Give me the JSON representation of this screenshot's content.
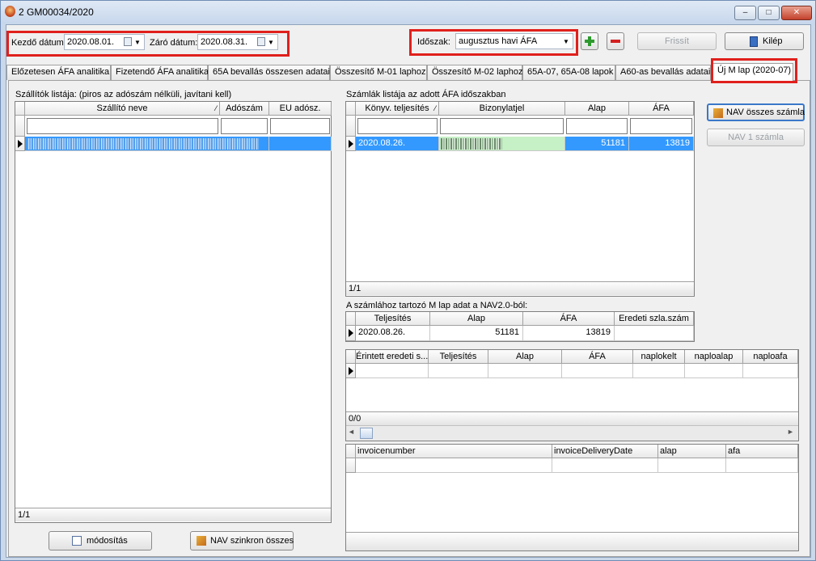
{
  "window": {
    "title": "2 GM00034/2020",
    "minimize": "–",
    "maximize": "□",
    "close": "✕"
  },
  "toolbar": {
    "start_label": "Kezdő dátum:",
    "start_value": "2020.08.01.",
    "end_label": "Záró dátum:",
    "end_value": "2020.08.31.",
    "period_label": "Időszak:",
    "period_value": "augusztus havi ÁFA",
    "refresh": "Frissít",
    "exit": "Kilép"
  },
  "tabs": [
    "Előzetesen ÁFA analitika",
    "Fizetendő ÁFA analitika",
    "65A bevallás összesen adatai",
    "Összesítő M-01 laphoz",
    "Összesítő M-02 laphoz",
    "65A-07, 65A-08 lapok",
    "A60-as bevallás adatai",
    "Új M lap (2020-07)"
  ],
  "suppliers": {
    "caption": "Szállítók listája: (piros az adószám nélküli, javítani kell)",
    "columns": [
      "Szállító neve",
      "Adószám",
      "EU adósz."
    ],
    "status": "1/1",
    "modify": "módosítás",
    "sync": "NAV szinkron összes"
  },
  "invoices": {
    "caption": "Számlák listája az adott ÁFA időszakban",
    "columns": [
      "Könyv. teljesítés",
      "Bizonylatjel",
      "Alap",
      "ÁFA"
    ],
    "rows": [
      {
        "date": "2020.08.26.",
        "alap": "51181",
        "afa": "13819"
      }
    ],
    "status": "1/1",
    "nav_all": "NAV összes számla",
    "nav_one": "NAV 1 számla"
  },
  "mlap": {
    "caption": "A számlához tartozó M lap adat a NAV2.0-ból:",
    "columns": [
      "Teljesítés",
      "Alap",
      "ÁFA",
      "Eredeti szla.szám"
    ],
    "rows": [
      {
        "date": "2020.08.26.",
        "alap": "51181",
        "afa": "13819",
        "orig": ""
      }
    ]
  },
  "affected": {
    "columns": [
      "Érintett eredeti s...",
      "Teljesítés",
      "Alap",
      "ÁFA",
      "naplokelt",
      "naploalap",
      "naploafa"
    ],
    "status": "0/0"
  },
  "navgrid": {
    "columns": [
      "invoicenumber",
      "invoiceDeliveryDate",
      "alap",
      "afa"
    ]
  }
}
